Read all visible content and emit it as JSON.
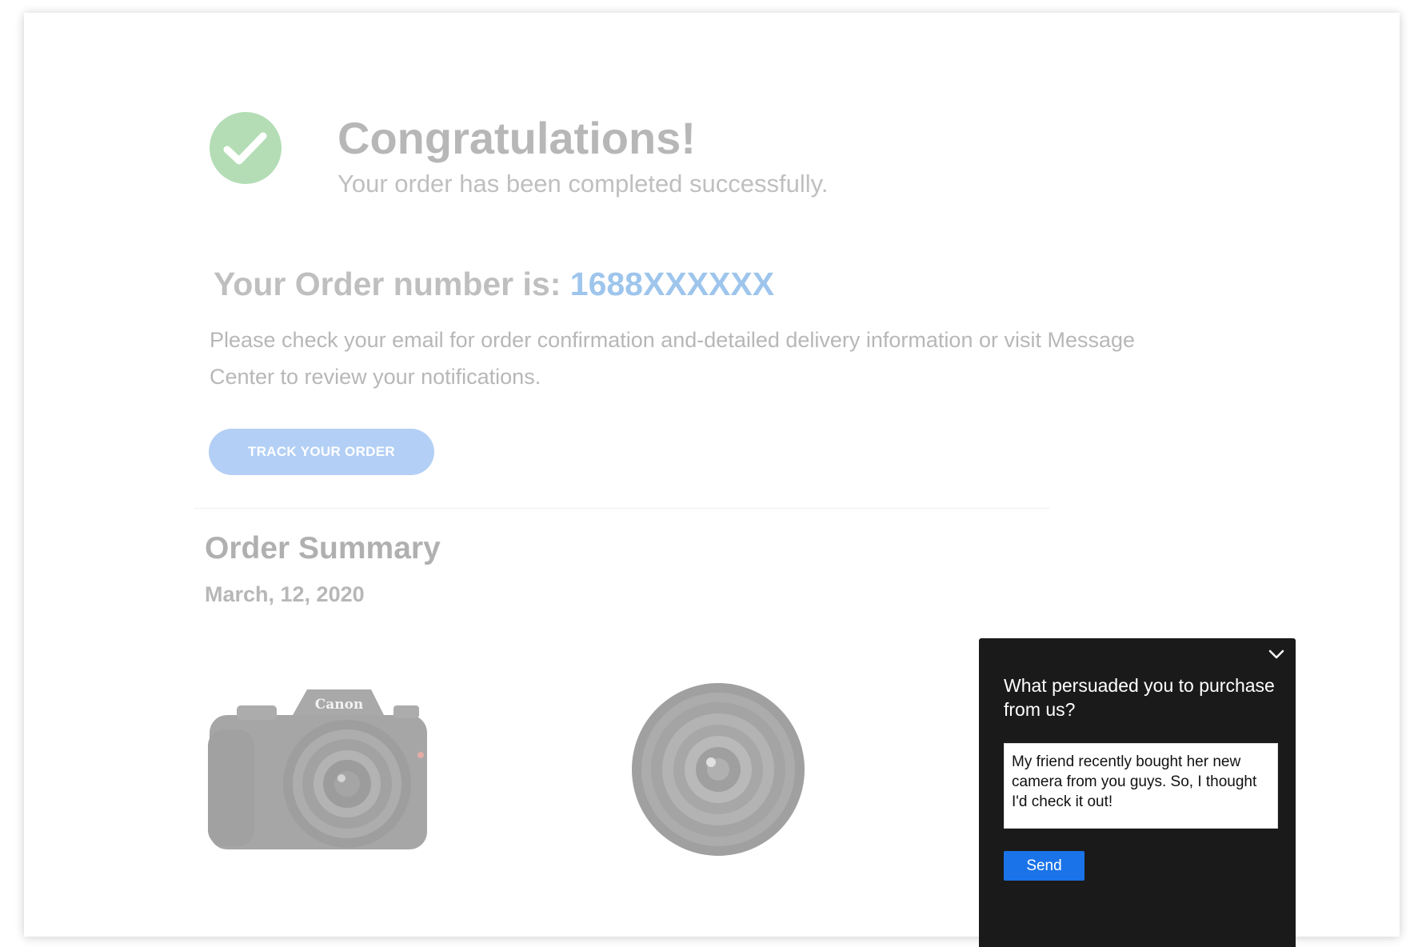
{
  "confirmation": {
    "title": "Congratulations!",
    "message": "Your order has been completed successfully.",
    "order_label": "Your Order number is: ",
    "order_number": "1688XXXXXX",
    "info_text": "Please check your email for order confirmation and-detailed delivery information or visit Message Center to review your notifications.",
    "track_button_label": "TRACK YOUR ORDER",
    "success_icon": "check-circle-icon"
  },
  "order_summary": {
    "title": "Order Summary",
    "date": "March, 12, 2020",
    "products": [
      {
        "name": "camera-image",
        "brand": "Canon"
      },
      {
        "name": "lens-image"
      }
    ]
  },
  "survey": {
    "question": "What persuaded you to purchase from us?",
    "answer": "My friend recently bought her new camera from you guys. So, I thought I'd check it out!",
    "send_label": "Send",
    "collapse_icon": "chevron-down-icon"
  },
  "colors": {
    "success_green": "#4caf50",
    "accent_blue": "#1976d2",
    "button_blue": "#4a8ee6",
    "send_blue": "#1a73e8",
    "survey_bg": "#1a1a1a"
  }
}
